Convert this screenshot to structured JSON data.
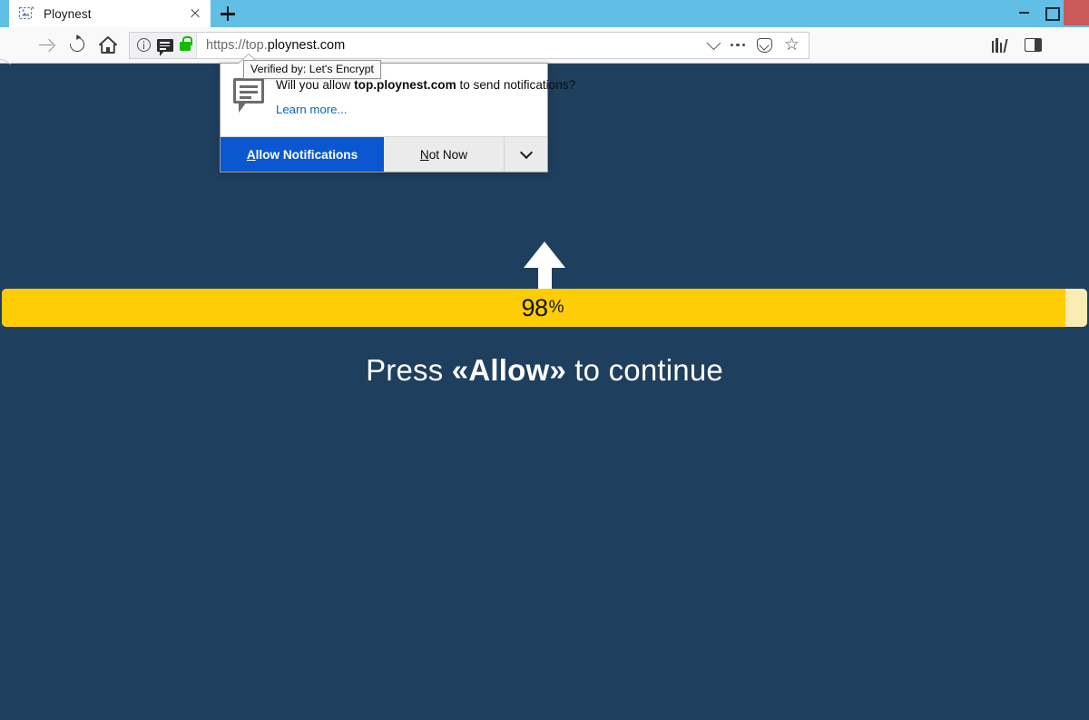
{
  "window": {
    "controls": {
      "minimize": "–",
      "maximize": "□",
      "close": "✕"
    }
  },
  "tabs": {
    "active": {
      "title": "Ploynest",
      "favicon": "broken-image-icon",
      "close_label": "✕"
    },
    "new_tab_label": "+"
  },
  "navigation": {
    "back": "back-arrow-icon",
    "forward": "forward-arrow-icon",
    "reload": "reload-icon",
    "home": "home-icon"
  },
  "urlbar": {
    "scheme_and_subdomain": "https://top.",
    "domain": "ploynest.com",
    "full_url": "https://top.ploynest.com",
    "identity_icons": [
      "info-icon",
      "notification-bubble-icon",
      "padlock-icon"
    ],
    "lock_color": "#12bc00",
    "right_icons": [
      "chevron-down-icon",
      "page-actions-ellipsis-icon",
      "pocket-icon",
      "bookmark-star-icon"
    ]
  },
  "toolbar": {
    "right_icons": [
      "library-icon",
      "sidebar-toggle-icon"
    ]
  },
  "tooltip": {
    "text": "Verified by: Let's Encrypt"
  },
  "popup": {
    "icon": "notification-bubble-icon",
    "message_prefix": "Will you allow ",
    "message_domain": "top.ploynest.com",
    "message_suffix": " to send notifications?",
    "learn_more": "Learn more...",
    "allow_button": "Allow Notifications",
    "allow_accesskey": "A",
    "not_now_button": "Not Now",
    "not_now_accesskey": "N",
    "dropdown_icon": "chevron-down-icon",
    "allow_color": "#0a57d0"
  },
  "page": {
    "background_color": "#1f3f5e",
    "arrow": "arrow-up-icon",
    "progress": {
      "percent": 98,
      "number_label": "98",
      "percent_sign": "%",
      "fill_color": "#ffcd06",
      "track_color": "#fbecb3"
    },
    "headline_prefix": "Press ",
    "headline_emphasis": "«Allow»",
    "headline_suffix": " to continue"
  }
}
